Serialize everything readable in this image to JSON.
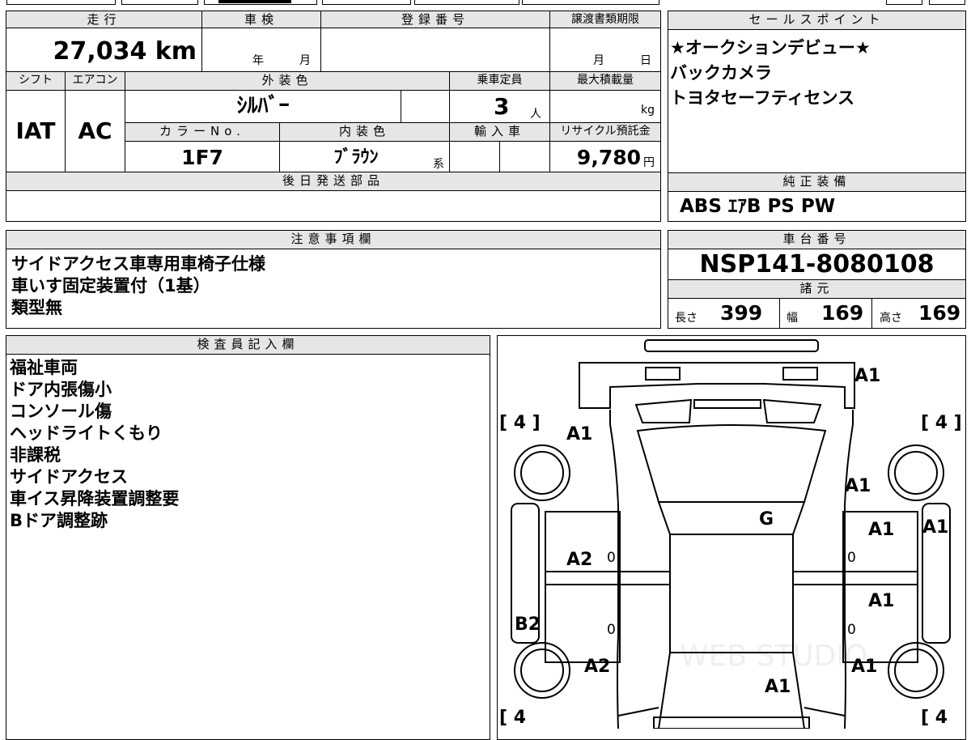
{
  "top_fragments": {
    "a": "…",
    "b": "…"
  },
  "vehicle": {
    "mileage_header": "走行",
    "mileage": "27,034",
    "mileage_unit": "km",
    "shaken_header": "車検",
    "shaken_year_unit": "年",
    "shaken_month_unit": "月",
    "registration_header": "登録番号",
    "registration_value": "",
    "transfer_header": "譲渡書類期限",
    "transfer_month_unit": "月",
    "transfer_day_unit": "日",
    "shift_header": "シフト",
    "shift": "IAT",
    "ac_header": "エアコン",
    "ac": "AC",
    "exterior_color_header": "外装色",
    "exterior_color": "ｼﾙﾊﾞｰ",
    "capacity_header": "乗車定員",
    "capacity": "3",
    "capacity_unit": "人",
    "max_load_header": "最大積載量",
    "max_load_unit": "kg",
    "color_no_header": "カラーNo.",
    "color_no": "1F7",
    "interior_color_header": "内装色",
    "interior_color": "ﾌﾞﾗｳﾝ",
    "interior_suffix": "系",
    "import_header": "輸入車",
    "recycle_header": "リサイクル預託金",
    "recycle_fee": "9,780",
    "recycle_unit": "円",
    "later_parts_header": "後日発送部品",
    "later_parts_value": ""
  },
  "sales_points": {
    "header": "セールスポイント",
    "items": [
      "★オークションデビュー★",
      "バックカメラ",
      "トヨタセーフティセンス"
    ]
  },
  "genuine_equipment": {
    "header": "純正装備",
    "value": "ABS ｴｱB PS PW"
  },
  "notes": {
    "header": "注意事項欄",
    "lines": [
      "サイドアクセス車専用車椅子仕様",
      "車いす固定装置付（1基）",
      "類型無"
    ]
  },
  "chassis": {
    "header": "車台番号",
    "number": "NSP141-8080108"
  },
  "specs": {
    "header": "諸元",
    "length_label": "長さ",
    "length": "399",
    "width_label": "幅",
    "width": "169",
    "height_label": "高さ",
    "height": "169"
  },
  "inspector": {
    "header": "検査員記入欄",
    "lines": [
      "福祉車両",
      "ドア内張傷小",
      "コンソール傷",
      "ヘッドライトくもり",
      "非課税",
      "サイドアクセス",
      "車イス昇降装置調整要",
      "Bドア調整跡"
    ]
  },
  "diagram": {
    "tire_marks": [
      "[ 4 ]",
      "[ 4 ]",
      "[ 4",
      "[ 4"
    ],
    "grades": [
      "A1",
      "A1",
      "A1",
      "A1",
      "A1",
      "A1",
      "A1",
      "A1",
      "A1",
      "G",
      "A2",
      "A2",
      "B2"
    ],
    "zeros": [
      "0",
      "0",
      "0",
      "0"
    ],
    "watermark": "WEB STUDIO"
  }
}
